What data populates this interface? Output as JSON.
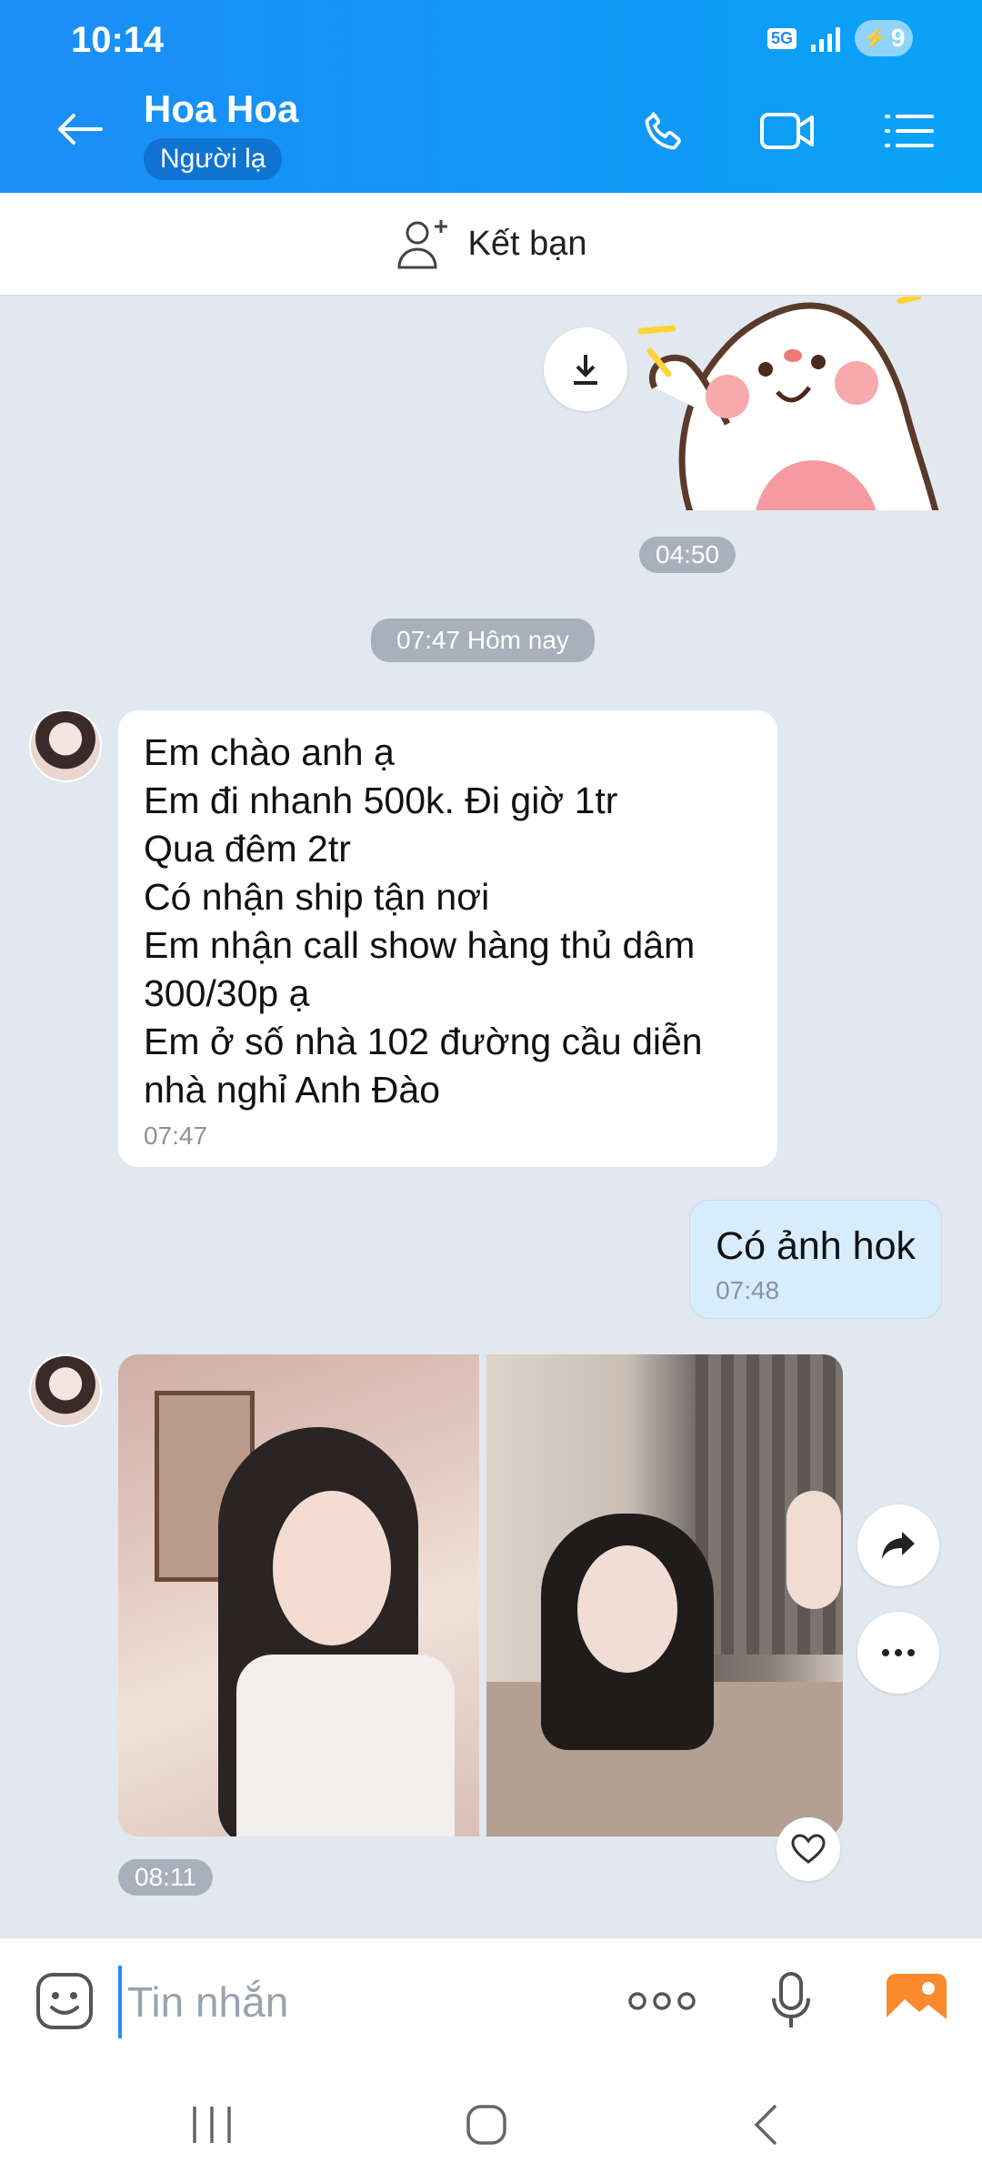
{
  "status_bar": {
    "time": "10:14",
    "network": "5G",
    "battery": "9"
  },
  "header": {
    "contact_name": "Hoa Hoa",
    "contact_status": "Người lạ"
  },
  "add_friend": {
    "label": "Kết bạn"
  },
  "messages": {
    "sticker_time": "04:50",
    "date_divider": "07:47 Hôm nay",
    "incoming_lines": [
      "Em chào anh ạ",
      "Em đi nhanh 500k. Đi giờ 1tr",
      "Qua đêm 2tr",
      "Có nhận ship tận nơi",
      "Em nhận call show hàng thủ dâm",
      "300/30p ạ",
      "Em ở số nhà 102 đường cầu diễn",
      "nhà nghỉ Anh Đào"
    ],
    "incoming_time": "07:47",
    "outgoing_text": "Có ảnh hok",
    "outgoing_time": "07:48",
    "photos_time": "08:11"
  },
  "input": {
    "placeholder": "Tin nhắn"
  },
  "colors": {
    "header_blue": "#1c8ef6",
    "chat_bg": "#e2e8f0",
    "outgoing_bubble": "#d7ecfd"
  }
}
